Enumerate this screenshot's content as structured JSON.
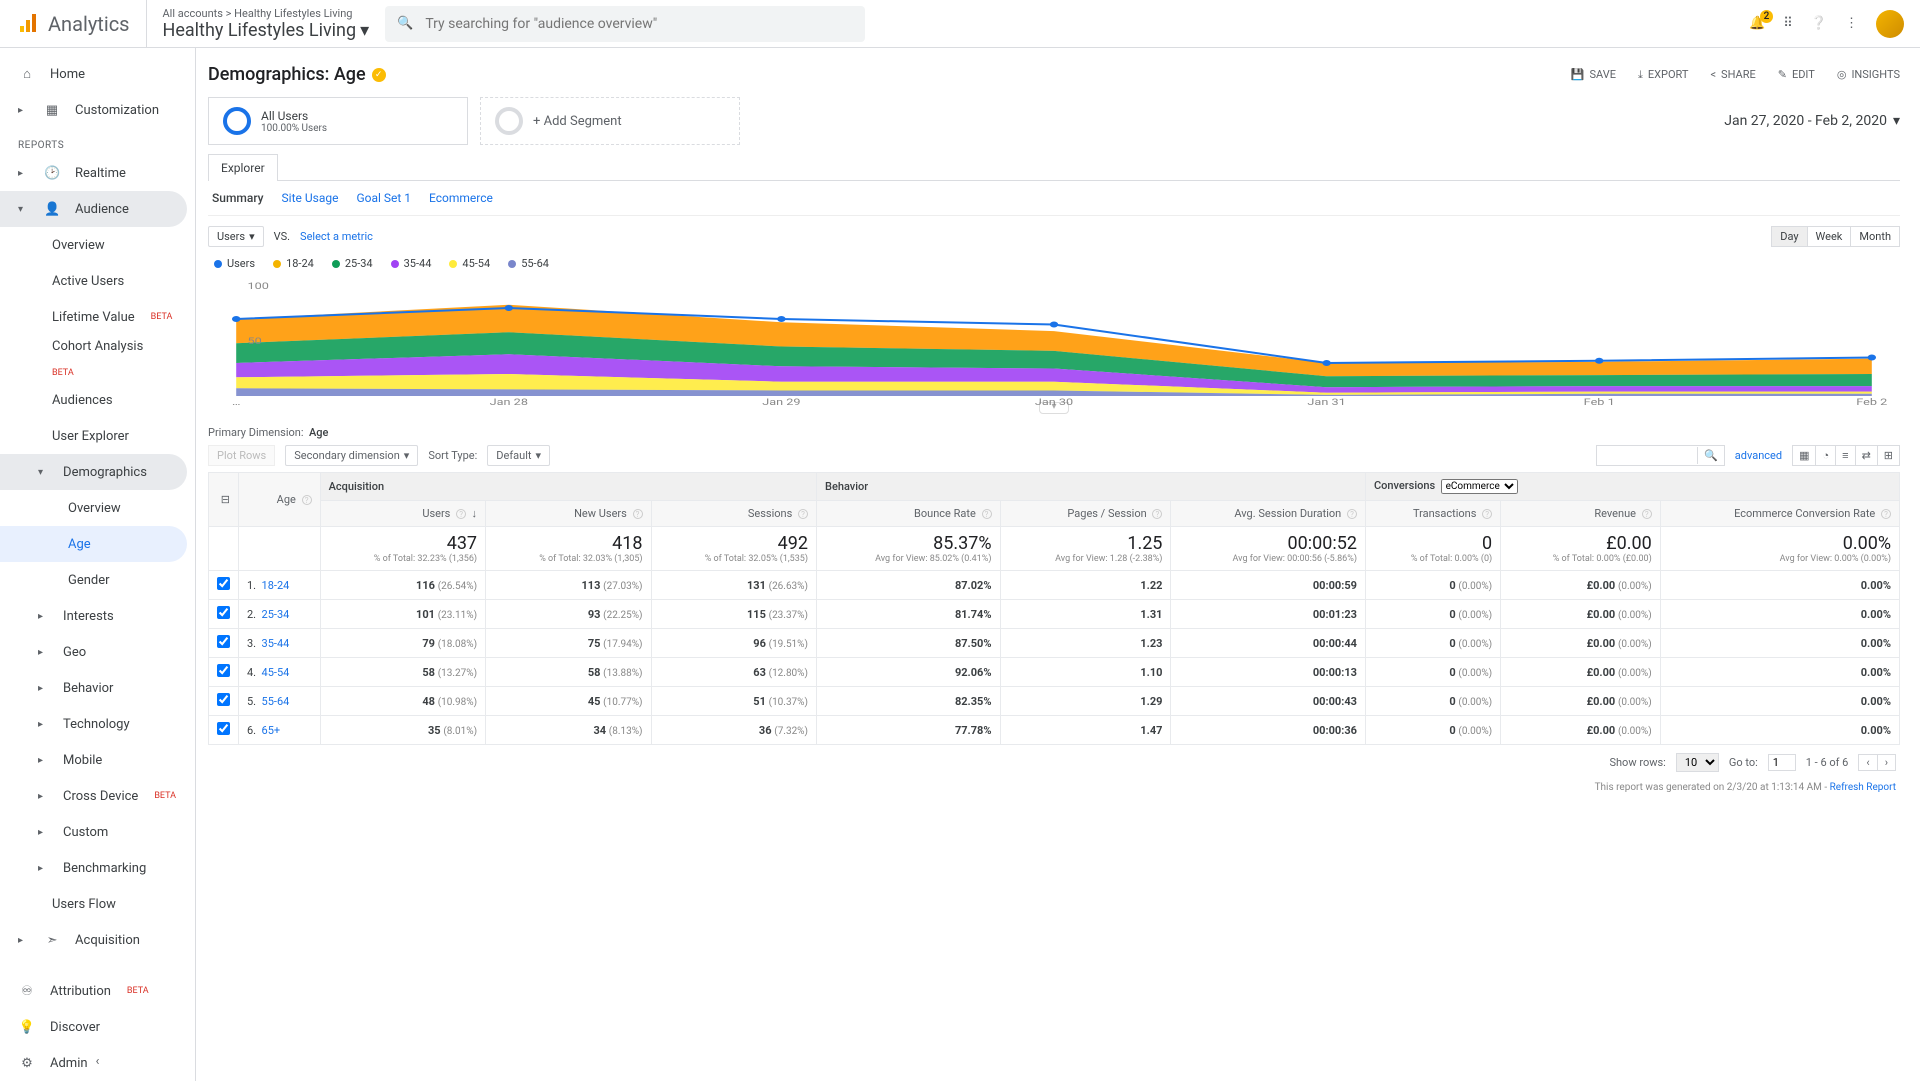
{
  "header": {
    "product": "Analytics",
    "breadcrumb": "All accounts > Healthy Lifestyles Living",
    "account": "Healthy Lifestyles Living",
    "search_placeholder": "Try searching for \"audience overview\"",
    "notif_count": "2"
  },
  "sidebar": {
    "home": "Home",
    "customization": "Customization",
    "reports_label": "REPORTS",
    "realtime": "Realtime",
    "audience": "Audience",
    "aud_items": {
      "overview": "Overview",
      "active_users": "Active Users",
      "lifetime_value": "Lifetime Value",
      "cohort": "Cohort Analysis",
      "audiences": "Audiences",
      "user_explorer": "User Explorer",
      "demographics": "Demographics",
      "demo_overview": "Overview",
      "demo_age": "Age",
      "demo_gender": "Gender",
      "interests": "Interests",
      "geo": "Geo",
      "behavior": "Behavior",
      "technology": "Technology",
      "mobile": "Mobile",
      "cross_device": "Cross Device",
      "custom": "Custom",
      "benchmarking": "Benchmarking",
      "users_flow": "Users Flow"
    },
    "acquisition": "Acquisition",
    "attribution": "Attribution",
    "discover": "Discover",
    "admin": "Admin",
    "beta": "BETA"
  },
  "page": {
    "title": "Demographics: Age",
    "actions": {
      "save": "SAVE",
      "export": "EXPORT",
      "share": "SHARE",
      "edit": "EDIT",
      "insights": "INSIGHTS"
    },
    "segment_all": "All Users",
    "segment_sub": "100.00% Users",
    "add_segment": "+ Add Segment",
    "daterange": "Jan 27, 2020 - Feb 2, 2020",
    "explorer": "Explorer",
    "subtabs": {
      "summary": "Summary",
      "site_usage": "Site Usage",
      "goal1": "Goal Set 1",
      "ecom": "Ecommerce"
    },
    "metric_sel": "Users",
    "vs": "VS.",
    "select_metric": "Select a metric",
    "time": {
      "day": "Day",
      "week": "Week",
      "month": "Month"
    },
    "prim_dim_label": "Primary Dimension:",
    "prim_dim_value": "Age",
    "plot_rows": "Plot Rows",
    "sec_dim": "Secondary dimension",
    "sort_type": "Sort Type:",
    "sort_default": "Default",
    "advanced": "advanced"
  },
  "legend": [
    {
      "label": "Users",
      "color": "#1a73e8"
    },
    {
      "label": "18-24",
      "color": "#f4b400"
    },
    {
      "label": "25-34",
      "color": "#0f9d58"
    },
    {
      "label": "35-44",
      "color": "#a142f4"
    },
    {
      "label": "45-54",
      "color": "#ffeb3b"
    },
    {
      "label": "55-64",
      "color": "#7986cb"
    }
  ],
  "chart_data": {
    "type": "area",
    "x": [
      "…",
      "Jan 28",
      "Jan 29",
      "Jan 30",
      "Jan 31",
      "Feb 1",
      "Feb 2"
    ],
    "ylabel_marks": [
      "50",
      "100"
    ],
    "series": [
      {
        "name": "Users",
        "color": "#1a73e8",
        "values": [
          70,
          80,
          70,
          65,
          30,
          32,
          35
        ]
      },
      {
        "name": "18-24",
        "color": "#ff9800",
        "values": [
          22,
          25,
          22,
          18,
          12,
          12,
          14
        ]
      },
      {
        "name": "25-34",
        "color": "#0f9d58",
        "values": [
          18,
          20,
          18,
          16,
          10,
          10,
          11
        ]
      },
      {
        "name": "35-44",
        "color": "#a142f4",
        "values": [
          13,
          18,
          14,
          12,
          5,
          5,
          5
        ]
      },
      {
        "name": "45-54",
        "color": "#ffeb3b",
        "values": [
          10,
          14,
          8,
          8,
          2,
          2,
          2
        ]
      },
      {
        "name": "55-64",
        "color": "#7986cb",
        "values": [
          7,
          6,
          5,
          5,
          1,
          2,
          2
        ]
      }
    ],
    "ylim": [
      0,
      100
    ]
  },
  "table": {
    "groups": {
      "acq": "Acquisition",
      "beh": "Behavior",
      "conv": "Conversions",
      "conv_sel": "eCommerce"
    },
    "dim_header": "Age",
    "cols": [
      "Users",
      "New Users",
      "Sessions",
      "Bounce Rate",
      "Pages / Session",
      "Avg. Session Duration",
      "Transactions",
      "Revenue",
      "Ecommerce Conversion Rate"
    ],
    "totals": [
      {
        "big": "437",
        "sm": "% of Total: 32.23% (1,356)"
      },
      {
        "big": "418",
        "sm": "% of Total: 32.03% (1,305)"
      },
      {
        "big": "492",
        "sm": "% of Total: 32.05% (1,535)"
      },
      {
        "big": "85.37%",
        "sm": "Avg for View: 85.02% (0.41%)"
      },
      {
        "big": "1.25",
        "sm": "Avg for View: 1.28 (-2.38%)"
      },
      {
        "big": "00:00:52",
        "sm": "Avg for View: 00:00:56 (-5.86%)"
      },
      {
        "big": "0",
        "sm": "% of Total: 0.00% (0)"
      },
      {
        "big": "£0.00",
        "sm": "% of Total: 0.00% (£0.00)"
      },
      {
        "big": "0.00%",
        "sm": "Avg for View: 0.00% (0.00%)"
      }
    ],
    "rows": [
      {
        "n": "1.",
        "dim": "18-24",
        "c": [
          [
            "116",
            "(26.54%)"
          ],
          [
            "113",
            "(27.03%)"
          ],
          [
            "131",
            "(26.63%)"
          ],
          [
            "87.02%",
            ""
          ],
          [
            "1.22",
            ""
          ],
          [
            "00:00:59",
            ""
          ],
          [
            "0",
            "(0.00%)"
          ],
          [
            "£0.00",
            "(0.00%)"
          ],
          [
            "0.00%",
            ""
          ]
        ]
      },
      {
        "n": "2.",
        "dim": "25-34",
        "c": [
          [
            "101",
            "(23.11%)"
          ],
          [
            "93",
            "(22.25%)"
          ],
          [
            "115",
            "(23.37%)"
          ],
          [
            "81.74%",
            ""
          ],
          [
            "1.31",
            ""
          ],
          [
            "00:01:23",
            ""
          ],
          [
            "0",
            "(0.00%)"
          ],
          [
            "£0.00",
            "(0.00%)"
          ],
          [
            "0.00%",
            ""
          ]
        ]
      },
      {
        "n": "3.",
        "dim": "35-44",
        "c": [
          [
            "79",
            "(18.08%)"
          ],
          [
            "75",
            "(17.94%)"
          ],
          [
            "96",
            "(19.51%)"
          ],
          [
            "87.50%",
            ""
          ],
          [
            "1.23",
            ""
          ],
          [
            "00:00:44",
            ""
          ],
          [
            "0",
            "(0.00%)"
          ],
          [
            "£0.00",
            "(0.00%)"
          ],
          [
            "0.00%",
            ""
          ]
        ]
      },
      {
        "n": "4.",
        "dim": "45-54",
        "c": [
          [
            "58",
            "(13.27%)"
          ],
          [
            "58",
            "(13.88%)"
          ],
          [
            "63",
            "(12.80%)"
          ],
          [
            "92.06%",
            ""
          ],
          [
            "1.10",
            ""
          ],
          [
            "00:00:13",
            ""
          ],
          [
            "0",
            "(0.00%)"
          ],
          [
            "£0.00",
            "(0.00%)"
          ],
          [
            "0.00%",
            ""
          ]
        ]
      },
      {
        "n": "5.",
        "dim": "55-64",
        "c": [
          [
            "48",
            "(10.98%)"
          ],
          [
            "45",
            "(10.77%)"
          ],
          [
            "51",
            "(10.37%)"
          ],
          [
            "82.35%",
            ""
          ],
          [
            "1.29",
            ""
          ],
          [
            "00:00:43",
            ""
          ],
          [
            "0",
            "(0.00%)"
          ],
          [
            "£0.00",
            "(0.00%)"
          ],
          [
            "0.00%",
            ""
          ]
        ]
      },
      {
        "n": "6.",
        "dim": "65+",
        "c": [
          [
            "35",
            "(8.01%)"
          ],
          [
            "34",
            "(8.13%)"
          ],
          [
            "36",
            "(7.32%)"
          ],
          [
            "77.78%",
            ""
          ],
          [
            "1.47",
            ""
          ],
          [
            "00:00:36",
            ""
          ],
          [
            "0",
            "(0.00%)"
          ],
          [
            "£0.00",
            "(0.00%)"
          ],
          [
            "0.00%",
            ""
          ]
        ]
      }
    ],
    "footer": {
      "show_rows": "Show rows:",
      "rows_val": "10",
      "goto": "Go to:",
      "goto_val": "1",
      "range": "1 - 6 of 6"
    },
    "gen_note": "This report was generated on 2/3/20 at 1:13:14 AM - ",
    "refresh": "Refresh Report"
  }
}
